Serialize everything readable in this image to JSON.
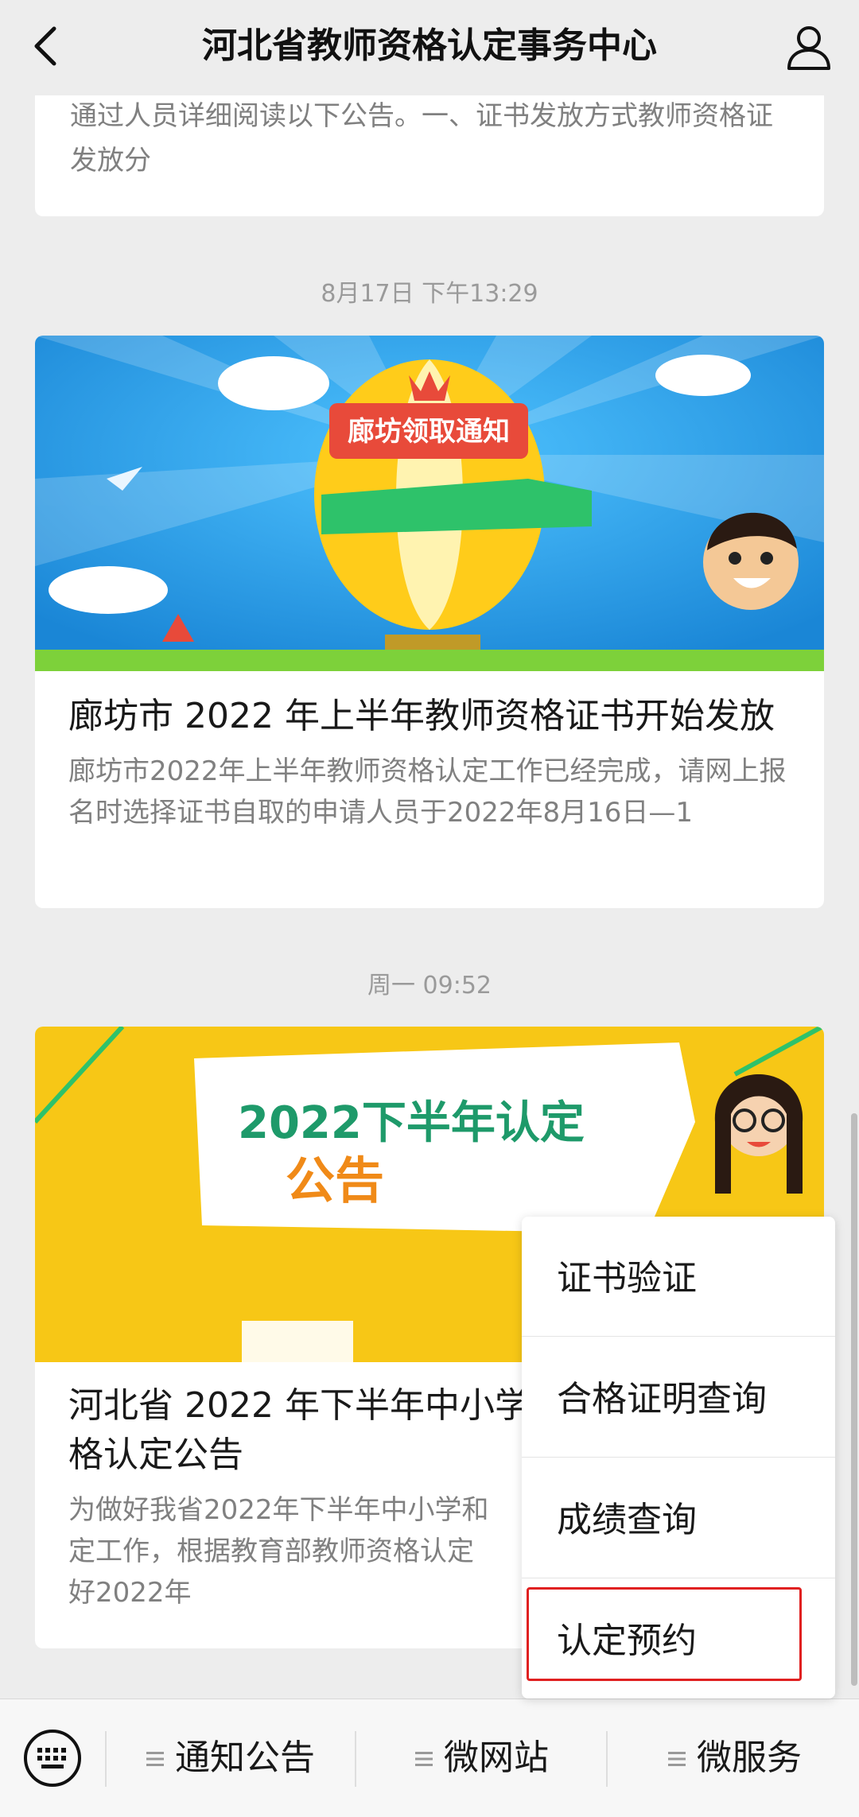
{
  "header": {
    "title": "河北省教师资格认定事务中心"
  },
  "messages": [
    {
      "snippet": "通过人员详细阅读以下公告。一、证书发放方式教师资格证发放分"
    },
    {
      "time": "8月17日 下午13:29",
      "banner_text": "廊坊领取通知",
      "title": "廊坊市 2022 年上半年教师资格证书开始发放",
      "desc": "廊坊市2022年上半年教师资格认定工作已经完成，请网上报名时选择证书自取的申请人员于2022年8月16日—1"
    },
    {
      "time": "周一 09:52",
      "banner_line1": "2022下半年认定",
      "banner_line2": "公告",
      "title": "河北省 2022 年下半年中小学",
      "title2": "格认定公告",
      "desc1": "为做好我省2022年下半年中小学和",
      "desc2": "定工作，根据教育部教师资格认定",
      "desc3": "好2022年"
    }
  ],
  "popup_menu": {
    "items": [
      "证书验证",
      "合格证明查询",
      "成绩查询",
      "认定预约"
    ],
    "highlighted": "认定预约",
    "highlight_color": "#e02020"
  },
  "bottom_menu": {
    "tabs": [
      "通知公告",
      "微网站",
      "微服务"
    ]
  }
}
